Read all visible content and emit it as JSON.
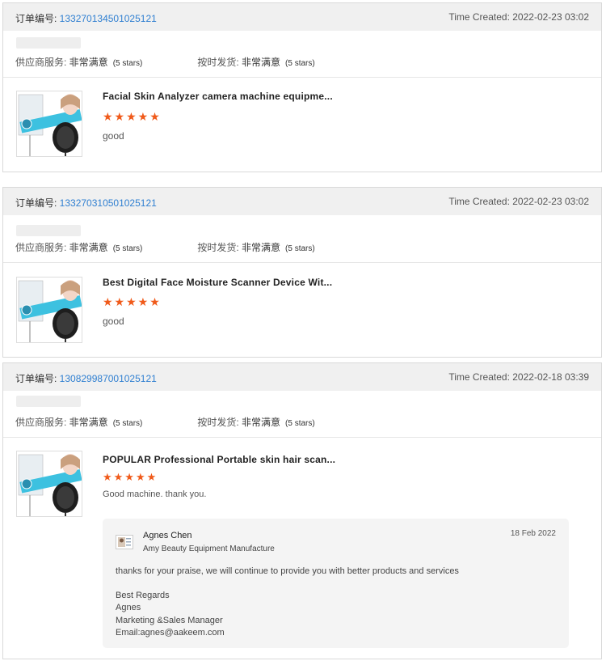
{
  "labels": {
    "order_prefix": "订单编号: ",
    "time_prefix": "Time Created: ",
    "supplier_service": "供应商服务: ",
    "on_time_delivery": "按时发货: ",
    "very_satisfied": "非常满意",
    "five_stars": "(5 stars)"
  },
  "orders": [
    {
      "order_number": "133270134501025121",
      "time_created": "2022-02-23 03:02",
      "product_title": "Facial Skin Analyzer camera machine equipme...",
      "stars": "★★★★★",
      "rating": 5,
      "comment": "good",
      "thumbnail_icon": "product-image-skin-analyzer"
    },
    {
      "order_number": "133270310501025121",
      "time_created": "2022-02-23 03:02",
      "product_title": "Best Digital Face Moisture Scanner Device Wit...",
      "stars": "★★★★★",
      "rating": 5,
      "comment": "good",
      "thumbnail_icon": "product-image-skin-analyzer"
    },
    {
      "order_number": "130829987001025121",
      "time_created": "2022-02-18 03:39",
      "product_title": "POPULAR Professional Portable skin hair scan...",
      "stars": "★★★★★",
      "rating": 5,
      "comment": "Good machine. thank you.",
      "thumbnail_icon": "product-image-skin-analyzer",
      "reply": {
        "name": "Agnes Chen",
        "company": "Amy Beauty Equipment Manufacture",
        "date": "18 Feb 2022",
        "body": "thanks for your praise, we will continue to provide you with better products and services",
        "sign_lines": [
          "Best Regards",
          "Agnes",
          "Marketing &Sales Manager",
          "Email:agnes@aakeem.com"
        ]
      }
    }
  ],
  "colors": {
    "order_link": "#2f7fd1",
    "star": "#f05a1a",
    "header_bg": "#f0f0f0",
    "reply_bg": "#f4f4f4"
  }
}
